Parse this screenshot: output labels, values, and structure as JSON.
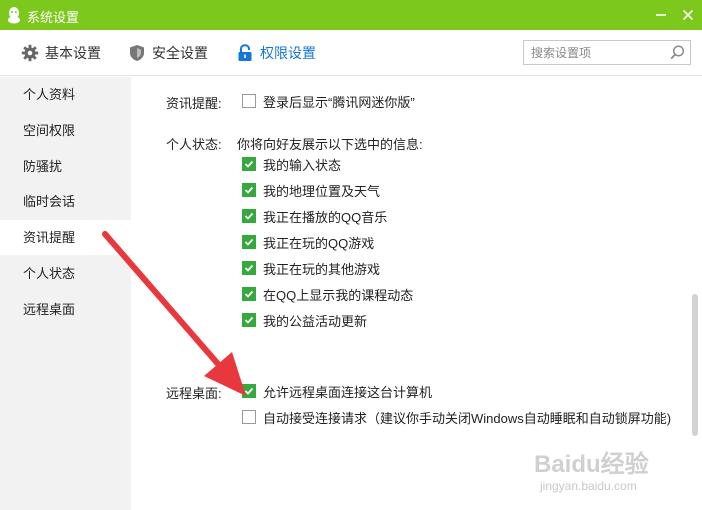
{
  "window": {
    "title": "系统设置",
    "brand_color": "#7cc81c"
  },
  "tabs": [
    {
      "label": "基本设置",
      "icon": "gear-icon",
      "active": false
    },
    {
      "label": "安全设置",
      "icon": "shield-icon",
      "active": false
    },
    {
      "label": "权限设置",
      "icon": "lock-icon",
      "active": true
    }
  ],
  "search": {
    "placeholder": "搜索设置项",
    "value": ""
  },
  "sidebar": {
    "items": [
      {
        "label": "个人资料"
      },
      {
        "label": "空间权限"
      },
      {
        "label": "防骚扰"
      },
      {
        "label": "临时会话"
      },
      {
        "label": "资讯提醒",
        "active": true
      },
      {
        "label": "个人状态"
      },
      {
        "label": "远程桌面"
      }
    ]
  },
  "news": {
    "label": "资讯提醒:",
    "option": {
      "label": "登录后显示“腾讯网迷你版”",
      "checked": false
    }
  },
  "status": {
    "label": "个人状态:",
    "hint": "你将向好友展示以下选中的信息:",
    "options": [
      {
        "label": "我的输入状态",
        "checked": true
      },
      {
        "label": "我的地理位置及天气",
        "checked": true
      },
      {
        "label": "我正在播放的QQ音乐",
        "checked": true
      },
      {
        "label": "我正在玩的QQ游戏",
        "checked": true
      },
      {
        "label": "我正在玩的其他游戏",
        "checked": true
      },
      {
        "label": "在QQ上显示我的课程动态",
        "checked": true
      },
      {
        "label": "我的公益活动更新",
        "checked": true
      }
    ]
  },
  "remote": {
    "label": "远程桌面:",
    "options": [
      {
        "label": "允许远程桌面连接这台计算机",
        "checked": true
      },
      {
        "label": "自动接受连接请求（建议你手动关闭Windows自动睡眠和自动锁屏功能)",
        "checked": false
      }
    ]
  },
  "colors": {
    "accent": "#1278d7",
    "check": "#35a93d",
    "arrow": "#e8383d"
  },
  "watermark": {
    "brand": "Baidu经验",
    "url": "jingyan.baidu.com"
  }
}
